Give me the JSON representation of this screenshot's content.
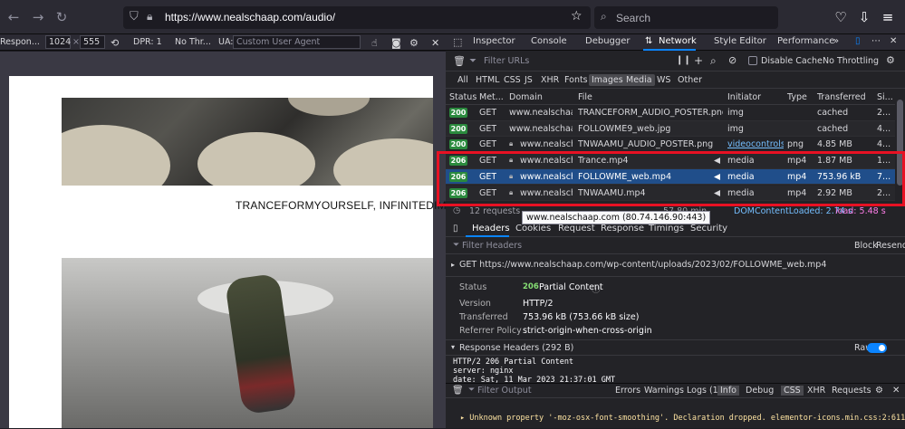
{
  "browser": {
    "url": "https://www.nealschaap.com/audio/",
    "search_placeholder": "Search"
  },
  "rdm": {
    "device": "Respon...",
    "width": "1024",
    "times": "×",
    "height": "555",
    "dpr": "DPR: 1",
    "throttle": "No Thr...",
    "ua_label": "UA:",
    "ua_placeholder": "Custom User Agent"
  },
  "page": {
    "caption": "TRANCEFORMYOURSELF, INFINITEDIMENS"
  },
  "devtools": {
    "tabs": [
      "Inspector",
      "Console",
      "Debugger",
      "Network",
      "Style Editor",
      "Performance"
    ],
    "selected_tab": "Network",
    "filter_placeholder": "Filter URLs",
    "disable_cache": "Disable Cache",
    "throttling": "No Throttling",
    "type_filters": [
      "All",
      "HTML",
      "CSS",
      "JS",
      "XHR",
      "Fonts",
      "Images",
      "Media",
      "WS",
      "Other"
    ],
    "active_filters": [
      "Images",
      "Media"
    ],
    "columns": [
      "Status",
      "Met...",
      "Domain",
      "File",
      "Initiator",
      "Type",
      "Transferred",
      "Si..."
    ],
    "rows": [
      {
        "status": "200",
        "method": "GET",
        "domain": "www.nealschaap.com",
        "file": "TRANCEFORM_AUDIO_POSTER.png",
        "initiator": "img",
        "type": "",
        "transferred": "cached",
        "size": "2...",
        "secure": false
      },
      {
        "status": "200",
        "method": "GET",
        "domain": "www.nealschaap.com",
        "file": "FOLLOWME9_web.jpg",
        "initiator": "img",
        "type": "",
        "transferred": "cached",
        "size": "4...",
        "secure": false
      },
      {
        "status": "200",
        "method": "GET",
        "domain": "www.nealsch...",
        "file": "TNWAAMU_AUDIO_POSTER.png",
        "initiator": "videocontrols...",
        "type": "png",
        "transferred": "4.85 MB",
        "size": "4...",
        "secure": true
      },
      {
        "status": "206",
        "method": "GET",
        "domain": "www.nealsch...",
        "file": "Trance.mp4",
        "initiator": "media",
        "type": "mp4",
        "transferred": "1.87 MB",
        "size": "1...",
        "secure": true
      },
      {
        "status": "206",
        "method": "GET",
        "domain": "www.nealsch...",
        "file": "FOLLOWME_web.mp4",
        "initiator": "media",
        "type": "mp4",
        "transferred": "753.96 kB",
        "size": "7...",
        "secure": true
      },
      {
        "status": "206",
        "method": "GET",
        "domain": "www.nealsch...",
        "file": "TNWAAMU.mp4",
        "initiator": "media",
        "type": "mp4",
        "transferred": "2.92 MB",
        "size": "2...",
        "secure": true
      }
    ],
    "summary": {
      "requests": "12 requests",
      "finish": "57.80 min",
      "dom": "DOMContentLoaded: 2.74 s",
      "load": "load: 5.48 s"
    },
    "tooltip": "www.nealschaap.com (80.74.146.90:443)",
    "detail_tabs": [
      "Headers",
      "Cookies",
      "Request",
      "Response",
      "Timings",
      "Security"
    ],
    "filter_headers": "Filter Headers",
    "block": "Block",
    "resend": "Resend",
    "request_line": "GET  https://www.nealschaap.com/wp-content/uploads/2023/02/FOLLOWME_web.mp4",
    "details": {
      "status_label": "Status",
      "status_code": "206",
      "status_text": "Partial Content",
      "version_label": "Version",
      "version": "HTTP/2",
      "transferred_label": "Transferred",
      "transferred": "753.96 kB (753.66 kB size)",
      "referrer_label": "Referrer Policy",
      "referrer": "strict-origin-when-cross-origin"
    },
    "response_headers": "Response Headers (292 B)",
    "raw_label": "Raw",
    "raw_lines": [
      "HTTP/2 206 Partial Content",
      "server: nginx",
      "date: Sat, 11 Mar 2023 21:37:01 GMT"
    ],
    "console": {
      "filter_placeholder": "Filter Output",
      "levels": [
        "Errors",
        "Warnings",
        "Logs (1)",
        "Info",
        "Debug",
        "CSS",
        "XHR",
        "Requests"
      ],
      "messages": [
        "▸ Unknown property '-moz-osx-font-smoothing'. Declaration dropped.   elementor-icons.min.css:2:611"
      ]
    }
  }
}
